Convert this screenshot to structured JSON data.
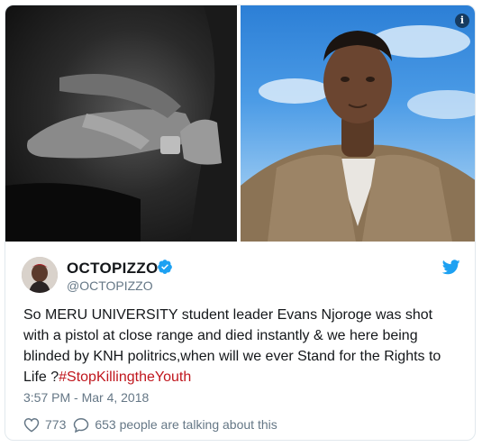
{
  "media": {
    "left_image": "black-and-white-hand-photo",
    "right_image": "portrait-photo-blue-sky",
    "info_icon": "info-icon"
  },
  "author": {
    "display_name": "OCTOPIZZO",
    "handle": "@OCTOPIZZO",
    "verified": true,
    "avatar": "avatar"
  },
  "tweet": {
    "text": "So MERU UNIVERSITY student leader Evans Njoroge was shot with a pistol at close range and died instantly & we here being blinded by KNH politrics,when will we ever Stand for the Rights to Life ?",
    "hashtag": "#StopKillingtheYouth",
    "timestamp": "3:57 PM - Mar 4, 2018"
  },
  "engagement": {
    "likes": "773",
    "talking": "653 people are talking about this"
  },
  "colors": {
    "brand": "#1da1f2",
    "hashtag": "#c0161d",
    "muted": "#657786",
    "text": "#14171a"
  }
}
